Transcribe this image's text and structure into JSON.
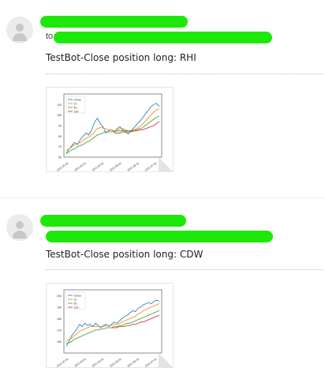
{
  "threads": [
    {
      "to_prefix": "to",
      "subject": "TestBot-Close position long: RHI",
      "attachment": {
        "icon": "image-attachment-icon",
        "chart_data": {
          "type": "line",
          "legend": [
            "Close",
            "21",
            "50",
            "100"
          ],
          "legend_position": "top-left",
          "ylim": [
            60,
            120
          ],
          "yticks": [
            "60",
            "70",
            "80",
            "90",
            "100",
            "110"
          ],
          "xticks": [
            "2021-02-01",
            "2021-03-01",
            "2021-04-01",
            "2021-05-01",
            "2021-06-01",
            "2021-07-01"
          ],
          "series": [
            {
              "name": "Close",
              "color": "#1f77b4",
              "values": [
                63,
                68,
                71,
                74,
                72,
                77,
                80,
                83,
                81,
                86,
                93,
                97,
                92,
                89,
                83,
                85,
                86,
                84,
                87,
                89,
                86,
                84,
                82,
                85,
                88,
                91,
                94,
                97,
                101,
                104,
                108,
                110,
                111,
                108
              ]
            },
            {
              "name": "21",
              "color": "#ff7f0e",
              "values": [
                66,
                68,
                70,
                72,
                73,
                74,
                76,
                78,
                79,
                81,
                84,
                87,
                88,
                88,
                87,
                86,
                86,
                85,
                86,
                87,
                87,
                86,
                85,
                85,
                86,
                87,
                89,
                91,
                94,
                97,
                100,
                103,
                105,
                106
              ]
            },
            {
              "name": "50",
              "color": "#2ca02c",
              "values": [
                64,
                65,
                67,
                68,
                70,
                71,
                72,
                74,
                75,
                77,
                79,
                81,
                82,
                83,
                84,
                84,
                84,
                84,
                85,
                85,
                85,
                85,
                85,
                85,
                85,
                86,
                87,
                88,
                90,
                92,
                94,
                96,
                98,
                99
              ]
            },
            {
              "name": "100",
              "color": "#d62728",
              "values": [
                null,
                null,
                null,
                null,
                null,
                null,
                null,
                null,
                null,
                null,
                null,
                null,
                null,
                null,
                null,
                null,
                null,
                83,
                83,
                83,
                84,
                84,
                84,
                84,
                85,
                85,
                86,
                86,
                87,
                88,
                89,
                90,
                92,
                94
              ]
            }
          ]
        }
      }
    },
    {
      "to_prefix": "",
      "subject": "TestBot-Close position long: CDW",
      "attachment": {
        "icon": "image-attachment-icon",
        "chart_data": {
          "type": "line",
          "legend": [
            "Close",
            "21",
            "50",
            "100"
          ],
          "legend_position": "top-left",
          "ylim": [
            150,
            205
          ],
          "yticks": [
            "160",
            "170",
            "180",
            "190",
            "200"
          ],
          "xticks": [
            "2021-02-01",
            "2021-03-01",
            "2021-04-01",
            "2021-05-01",
            "2021-06-01",
            "2021-07-01"
          ],
          "series": [
            {
              "name": "Close",
              "color": "#1f77b4",
              "values": [
                156,
                160,
                165,
                168,
                171,
                175,
                173,
                176,
                174,
                175,
                173,
                176,
                174,
                172,
                174,
                175,
                173,
                175,
                177,
                176,
                178,
                180,
                182,
                183,
                185,
                187,
                186,
                189,
                190,
                192,
                193,
                194,
                193,
                195,
                196,
                195
              ]
            },
            {
              "name": "21",
              "color": "#ff7f0e",
              "values": [
                160,
                162,
                163,
                165,
                167,
                169,
                170,
                171,
                172,
                173,
                173,
                173,
                173,
                173,
                173,
                174,
                174,
                174,
                175,
                175,
                176,
                177,
                178,
                179,
                180,
                181,
                182,
                184,
                185,
                187,
                188,
                189,
                190,
                191,
                192,
                193
              ]
            },
            {
              "name": "50",
              "color": "#2ca02c",
              "values": [
                158,
                159,
                160,
                162,
                163,
                164,
                165,
                166,
                167,
                168,
                169,
                170,
                170,
                171,
                171,
                172,
                172,
                172,
                173,
                173,
                174,
                174,
                175,
                176,
                176,
                177,
                178,
                179,
                180,
                181,
                182,
                183,
                184,
                185,
                186,
                187
              ]
            },
            {
              "name": "100",
              "color": "#d62728",
              "values": [
                null,
                null,
                null,
                null,
                null,
                null,
                null,
                null,
                null,
                null,
                null,
                null,
                null,
                null,
                null,
                null,
                null,
                172,
                172,
                172,
                173,
                173,
                173,
                174,
                174,
                175,
                175,
                176,
                177,
                177,
                178,
                179,
                180,
                181,
                182,
                183
              ]
            }
          ]
        }
      }
    }
  ]
}
